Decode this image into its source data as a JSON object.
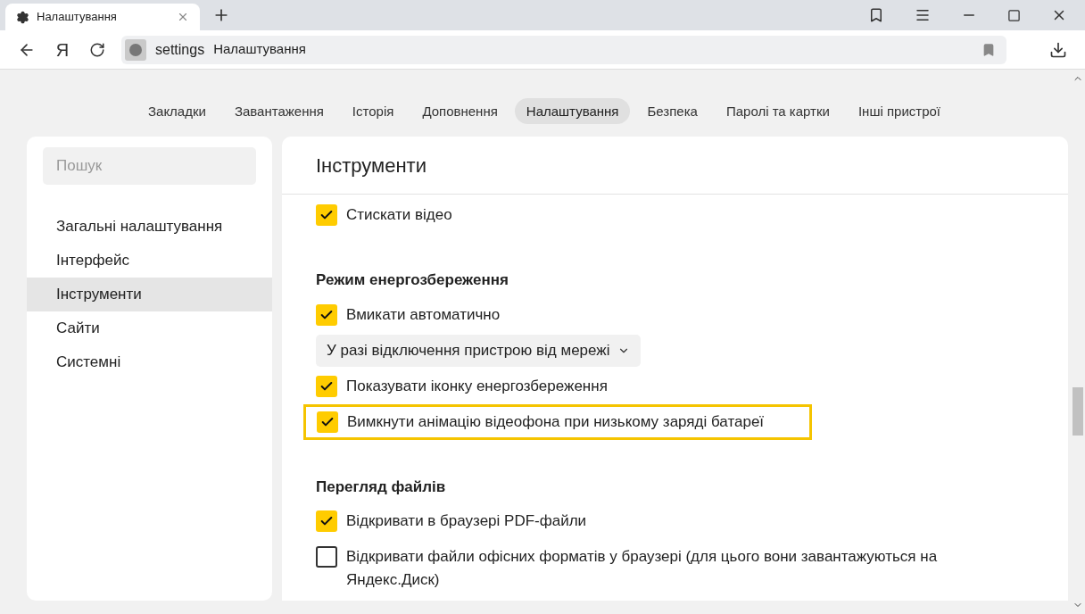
{
  "browser_tab": {
    "title": "Налаштування"
  },
  "address_bar": {
    "prefix": "settings",
    "title": "Налаштування"
  },
  "yandex_button": "Я",
  "nav_tabs": [
    {
      "label": "Закладки",
      "selected": false
    },
    {
      "label": "Завантаження",
      "selected": false
    },
    {
      "label": "Історія",
      "selected": false
    },
    {
      "label": "Доповнення",
      "selected": false
    },
    {
      "label": "Налаштування",
      "selected": true
    },
    {
      "label": "Безпека",
      "selected": false
    },
    {
      "label": "Паролі та картки",
      "selected": false
    },
    {
      "label": "Інші пристрої",
      "selected": false
    }
  ],
  "sidebar": {
    "search": {
      "placeholder": "Пошук"
    },
    "items": [
      {
        "label": "Загальні налаштування",
        "selected": false
      },
      {
        "label": "Інтерфейс",
        "selected": false
      },
      {
        "label": "Інструменти",
        "selected": true
      },
      {
        "label": "Сайти",
        "selected": false
      },
      {
        "label": "Системні",
        "selected": false
      }
    ]
  },
  "main": {
    "title": "Інструменти",
    "sections": [
      {
        "items": [
          {
            "kind": "checkbox",
            "label": "Стискати відео",
            "checked": true,
            "highlighted": false
          }
        ]
      },
      {
        "heading": "Режим енергозбереження",
        "items": [
          {
            "kind": "checkbox",
            "label": "Вмикати автоматично",
            "checked": true,
            "highlighted": false
          },
          {
            "kind": "select",
            "label": "У разі відключення пристрою від мережі"
          },
          {
            "kind": "checkbox",
            "label": "Показувати іконку енергозбереження",
            "checked": true,
            "highlighted": false
          },
          {
            "kind": "checkbox",
            "label": "Вимкнути анімацію відеофона при низькому заряді батареї",
            "checked": true,
            "highlighted": true
          }
        ]
      },
      {
        "heading": "Перегляд файлів",
        "items": [
          {
            "kind": "checkbox",
            "label": "Відкривати в браузері PDF-файли",
            "checked": true,
            "highlighted": false
          },
          {
            "kind": "checkbox",
            "label": "Відкривати файли офісних форматів у браузері (для цього вони завантажуються на Яндекс.Диск)",
            "checked": false,
            "highlighted": false
          }
        ]
      }
    ]
  }
}
